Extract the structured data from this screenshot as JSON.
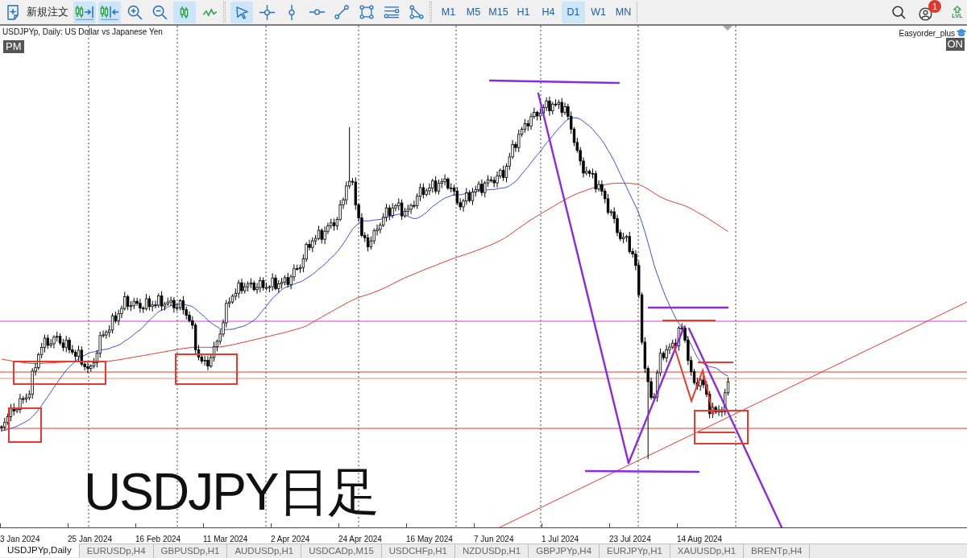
{
  "toolbar": {
    "new_order": {
      "label": "新規注文"
    },
    "chart_buttons": [
      {
        "kind": "chart-shift",
        "selected": true
      },
      {
        "kind": "autoscroll",
        "selected": true
      },
      {
        "kind": "zoom-in",
        "selected": false
      },
      {
        "kind": "zoom-out",
        "selected": false
      },
      {
        "kind": "candlesticks",
        "selected": true
      },
      {
        "kind": "line-chart",
        "selected": false
      }
    ],
    "drawing_tools": [
      {
        "kind": "cursor",
        "selected": true
      },
      {
        "kind": "crosshair",
        "selected": false
      },
      {
        "kind": "vertical-line",
        "selected": false
      },
      {
        "kind": "horizontal-line",
        "selected": false
      },
      {
        "kind": "trend-line",
        "selected": false
      },
      {
        "kind": "rectangle",
        "selected": false
      },
      {
        "kind": "channel",
        "selected": false
      },
      {
        "kind": "triangle",
        "selected": false
      }
    ],
    "timeframes": [
      {
        "label": "M1",
        "selected": false
      },
      {
        "label": "M5",
        "selected": false
      },
      {
        "label": "M15",
        "selected": false
      },
      {
        "label": "H1",
        "selected": false
      },
      {
        "label": "H4",
        "selected": false
      },
      {
        "label": "D1",
        "selected": true
      },
      {
        "label": "W1",
        "selected": false
      },
      {
        "label": "MN",
        "selected": false
      }
    ],
    "notifications": {
      "count": "1"
    },
    "level_button": {
      "label": "LVL"
    }
  },
  "chart": {
    "title": "USDJPYp, Daily: US Dollar vs Japanese Yen",
    "period_badge": "PM",
    "expert": {
      "name": "Easyorder_plus",
      "status": "ON"
    },
    "caption": "USDJPY日足",
    "x_axis_labels": [
      "3 Jan 2024",
      "25 Jan 2024",
      "16 Feb 2024",
      "11 Mar 2024",
      "2 Apr 2024",
      "24 Apr 2024",
      "16 May 2024",
      "7 Jun 2024",
      "1 Jul 2024",
      "23 Jul 2024",
      "14 Aug 2024"
    ]
  },
  "tabs": [
    {
      "label": "USDJPYp,Daily",
      "selected": true
    },
    {
      "label": "EURUSDp,H4",
      "selected": false
    },
    {
      "label": "GBPUSDp,H1",
      "selected": false
    },
    {
      "label": "AUDUSDp,H1",
      "selected": false
    },
    {
      "label": "USDCADp,M15",
      "selected": false
    },
    {
      "label": "USDCHFp,H1",
      "selected": false
    },
    {
      "label": "NZDUSDp,H1",
      "selected": false
    },
    {
      "label": "GBPJPYp,H4",
      "selected": false
    },
    {
      "label": "EURJPYp,H1",
      "selected": false
    },
    {
      "label": "XAUUSDp,H1",
      "selected": false
    },
    {
      "label": "BRENTp,H4",
      "selected": false
    }
  ]
}
